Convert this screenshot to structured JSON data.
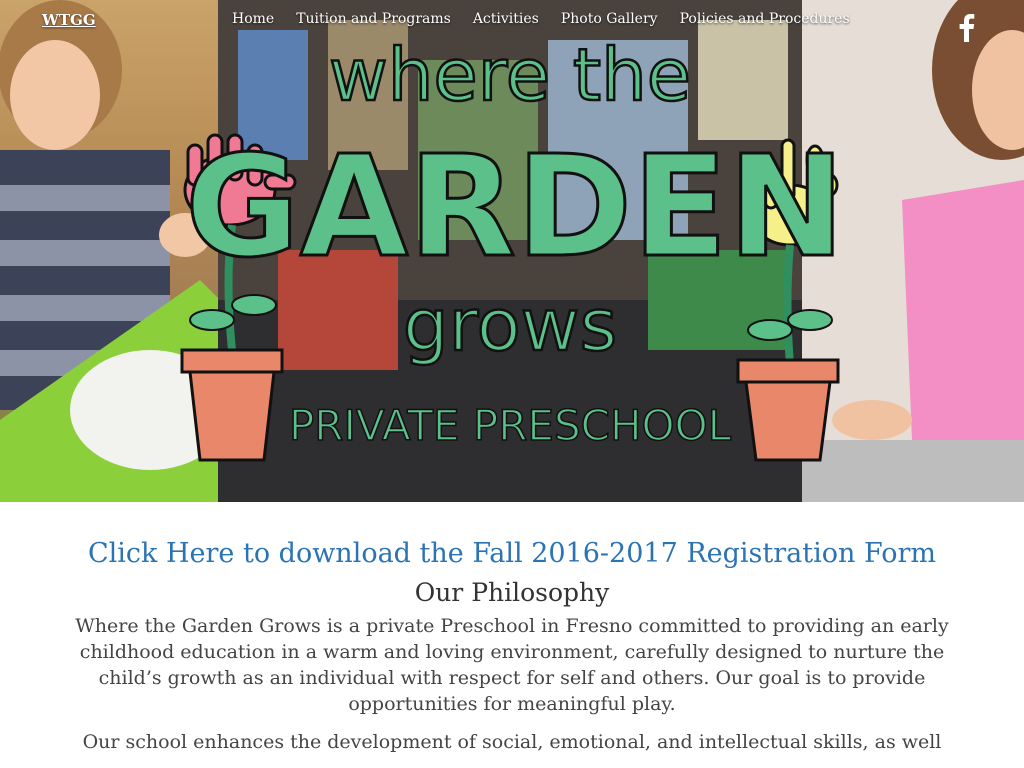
{
  "nav": {
    "brand": "WTGG",
    "items": [
      "Home",
      "Tuition and Programs",
      "Activities",
      "Photo Gallery",
      "Policies and Procedures"
    ],
    "social_icon": "facebook-icon"
  },
  "hero": {
    "logo_line1": "where the",
    "logo_line2": "GARDEN",
    "logo_line3": "grows",
    "logo_line4": "PRIVATE PRESCHOOL",
    "colors": {
      "logo_green": "#2f8f5f",
      "logo_fill": "#5cc08a",
      "hand_pink": "#f07a93",
      "hand_yellow": "#f6f08a",
      "pot": "#e8876a"
    }
  },
  "main": {
    "registration_link": "Click Here to download the Fall 2016-2017 Registration Form",
    "philosophy_title": "Our Philosophy",
    "paragraph1": "Where the Garden Grows is a private Preschool in Fresno committed to providing an early childhood education in a warm and loving environment, carefully designed to nurture the child’s growth as an individual with respect for self and others. Our goal is to provide opportunities for meaningful play.",
    "paragraph2": "Our school enhances the development of social, emotional, and intellectual skills, as well"
  },
  "colors": {
    "link": "#2a73b5",
    "body_text": "#444444"
  }
}
